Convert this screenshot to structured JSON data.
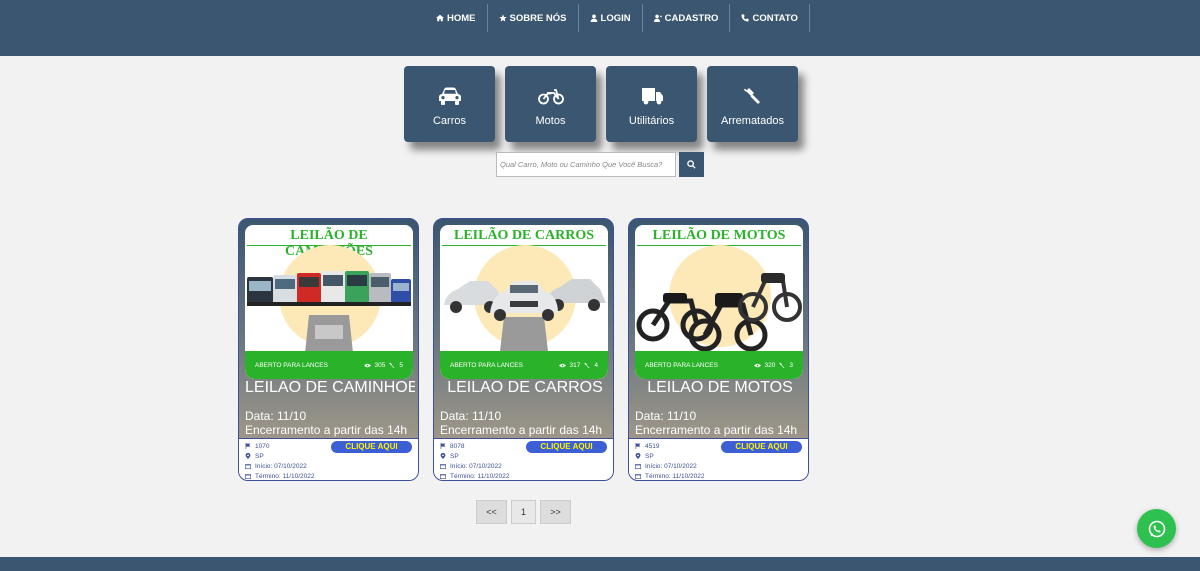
{
  "nav": [
    {
      "label": "HOME",
      "icon": "home-icon"
    },
    {
      "label": "SOBRE NÓS",
      "icon": "star-icon"
    },
    {
      "label": "LOGIN",
      "icon": "user-icon"
    },
    {
      "label": "CADASTRO",
      "icon": "user-plus-icon"
    },
    {
      "label": "CONTATO",
      "icon": "phone-icon"
    }
  ],
  "categories": [
    {
      "label": "Carros",
      "icon": "car-icon"
    },
    {
      "label": "Motos",
      "icon": "motorcycle-icon"
    },
    {
      "label": "Utilitários",
      "icon": "truck-icon"
    },
    {
      "label": "Arrematados",
      "icon": "gavel-icon"
    }
  ],
  "search": {
    "placeholder": "Qual Carro, Moto ou Caminho Que Você Busca?"
  },
  "cards": [
    {
      "banner": "LEILÃO DE CAMINHÕES",
      "status": "ABERTO PARA LANCES",
      "views": "305",
      "bids": "5",
      "title": "LEILAO DE CAMINHOES",
      "date": "Data: 11/10",
      "end": "Encerramento a partir das 14h",
      "lot": "1070",
      "state": "SP",
      "start": "Início: 07/10/2022",
      "finish": "Término: 11/10/2022",
      "cta": "CLIQUE AQUI"
    },
    {
      "banner": "LEILÃO DE CARROS",
      "status": "ABERTO PARA LANCES",
      "views": "317",
      "bids": "4",
      "title": "LEILAO DE CARROS",
      "date": "Data: 11/10",
      "end": "Encerramento a partir das 14h",
      "lot": "8078",
      "state": "SP",
      "start": "Início: 07/10/2022",
      "finish": "Término: 11/10/2022",
      "cta": "CLIQUE AQUI"
    },
    {
      "banner": "LEILÃO DE MOTOS",
      "status": "ABERTO PARA LANCES",
      "views": "320",
      "bids": "3",
      "title": "LEILAO DE MOTOS",
      "date": "Data: 11/10",
      "end": "Encerramento a partir das 14h",
      "lot": "4519",
      "state": "SP",
      "start": "Início: 07/10/2022",
      "finish": "Término: 11/10/2022",
      "cta": "CLIQUE AQUI"
    }
  ],
  "pagination": {
    "prev": "<<",
    "page": "1",
    "next": ">>"
  },
  "colors": {
    "primary": "#3b5670",
    "green": "#2ab32a",
    "blue": "#3d5fd6",
    "yellow": "#fdf200",
    "whatsapp": "#2ec14f"
  }
}
